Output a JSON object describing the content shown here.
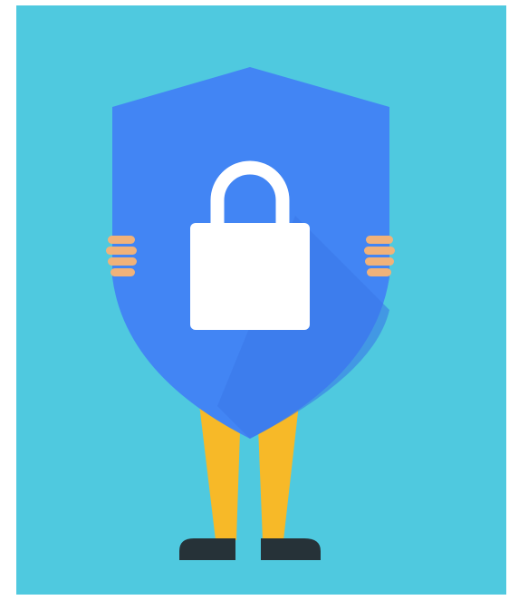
{
  "illustration": {
    "subject": "person-holding-security-shield",
    "icon": "lock-icon",
    "colors": {
      "background": "#4fc9df",
      "shield": "#4285f4",
      "shield_shadow": "#3b78e7",
      "lock": "#ffffff",
      "legs": "#f7b928",
      "skin": "#f0b27a",
      "shoes": "#263238"
    }
  }
}
